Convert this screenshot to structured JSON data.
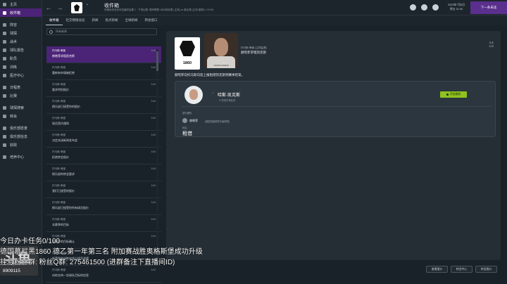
{
  "sidebar": {
    "items": [
      {
        "label": "主页",
        "active": false
      },
      {
        "label": "收件箱",
        "active": true
      },
      {
        "label": "阵容",
        "active": false
      },
      {
        "label": "球探",
        "active": false
      },
      {
        "label": "战术",
        "active": false
      },
      {
        "label": "球队报告",
        "active": false
      },
      {
        "label": "职员",
        "active": false
      },
      {
        "label": "训练",
        "active": false
      },
      {
        "label": "医疗中心",
        "active": false
      },
      {
        "label": "日程表",
        "active": false
      },
      {
        "label": "比赛",
        "active": false
      },
      {
        "label": "球探搜索",
        "active": false
      },
      {
        "label": "转会",
        "active": false
      },
      {
        "label": "俱乐部愿景",
        "active": false
      },
      {
        "label": "俱乐部信息",
        "active": false
      },
      {
        "label": "财政",
        "active": false
      },
      {
        "label": "培养中心",
        "active": false
      }
    ]
  },
  "topbar": {
    "title": "收件箱",
    "subtitle": "任期尚未还未评估最终结果 1 · 下场比赛: 德甲联赛·1860慕尼黑 (主场) vs 莱比锡 (主场 星期六 19:00)",
    "date_line1": "2023年7月6日",
    "date_line2": "周五 21:00",
    "continue_label": "下一条未读"
  },
  "tabs": [
    "收件箱",
    "社交网络动态",
    "新闻",
    "焦点新闻",
    "全球新闻",
    "转会窗口"
  ],
  "list": {
    "search_placeholder": "所有新闻",
    "messages": [
      {
        "from": "托马斯·蒂曼",
        "subject": "赫嗒菲求租凯克斯",
        "time": "8:48",
        "selected": true
      },
      {
        "from": "托马斯·蒂曼",
        "subject": "重新有申请被拒绝",
        "time": "8:46",
        "selected": false
      },
      {
        "from": "托马斯·蒂曼",
        "subject": "要求特别报价",
        "time": "8:46",
        "selected": false
      },
      {
        "from": "托马斯·蒂曼",
        "subject": "俱乐部已接受你的报价",
        "time": "8:46",
        "selected": false
      },
      {
        "from": "托马斯·蒂曼",
        "subject": "球员签约通知",
        "time": "8:45",
        "selected": false
      },
      {
        "from": "托马斯·蒂曼",
        "subject": "决定关闭新闻发布会",
        "time": "8:45",
        "selected": false
      },
      {
        "from": "托马斯·蒂曼",
        "subject": "拒绝转会报价",
        "time": "8:45",
        "selected": false
      },
      {
        "from": "托马斯·蒂曼",
        "subject": "俱乐部的转会要求",
        "time": "8:45",
        "selected": false
      },
      {
        "from": "托马斯·蒂曼",
        "subject": "我们已接受的报价",
        "time": "8:45",
        "selected": false
      },
      {
        "from": "托马斯·蒂曼",
        "subject": "俱乐部已接受你所有球员报价",
        "time": "8:45",
        "selected": false
      },
      {
        "from": "托马斯·蒂曼",
        "subject": "本赛季的目标",
        "time": "8:45",
        "selected": false
      },
      {
        "from": "托马斯·蒂曼",
        "subject": "本赛季的目标确认",
        "time": "8:45",
        "selected": false
      },
      {
        "from": "托马斯·蒂曼",
        "subject": "新赛季的训练安排与球员选择",
        "time": "8:45",
        "selected": false
      },
      {
        "from": "托马斯·蒂曼",
        "subject": "向你交待一些球队目标的信息",
        "time": "8:45",
        "selected": false
      }
    ]
  },
  "message": {
    "crest_year": "1860",
    "avatar_caption": "THOMAS TIEMAN",
    "from": "托马斯·蒂曼 (主球监督)",
    "subject": "赫嗒菲求租凯克斯",
    "time_line1": "今天",
    "time_line2": "8:48",
    "body": "赫嗒菲向托马斯向您上报租借凯克斯到赛季结束。",
    "card": {
      "player_name": "哈斯·凯克斯",
      "player_sub": "27岁的中场队员",
      "negotiate_label": "开启磋商",
      "interested_label": "感兴趣的",
      "interested_club": "赫嗒菲",
      "interested_note": "(韩国顶级联赛中级联赛)",
      "type_label": "转会",
      "type_value": "租借"
    }
  },
  "bottom_buttons": [
    "查看报价",
    "转会中心",
    "转会报价"
  ],
  "overlay": {
    "line1": "今日办卡任务0/100",
    "line2": "德国慕尼黑1860 德乙第一年第三名 附加赛战胜奥格斯堡成功升级",
    "line3": "挂号粉丝群: 粉丝Q群: 275461500 (进群备注下直播间ID)",
    "wm_logo": "斗鱼",
    "wm_sub": "douyu.com",
    "room_id": "8909115"
  },
  "colors": {
    "accent": "#4b2377",
    "negotiate_button": "#8fc21f",
    "background": "#1a2229"
  }
}
